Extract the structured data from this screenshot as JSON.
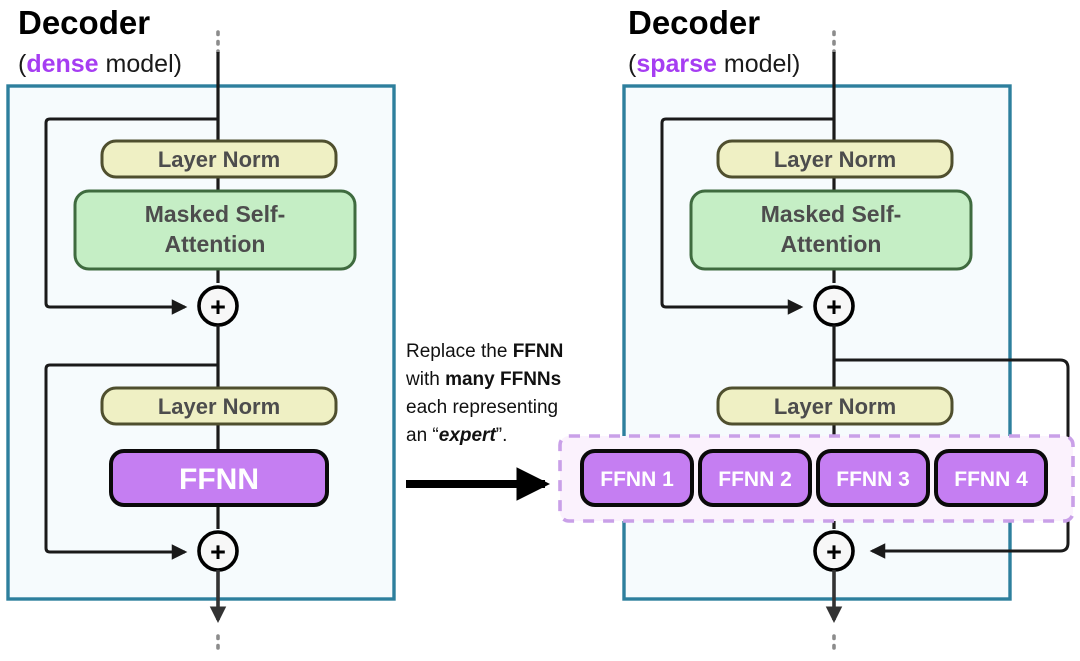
{
  "colors": {
    "background": "#ffffff",
    "decoder_border": "#2d7f9d",
    "decoder_fill": "#f6fbfd",
    "layernorm_fill": "#eff0c4",
    "layernorm_border": "#4f4f2e",
    "attention_fill": "#c5eec5",
    "attention_border": "#3f6b3f",
    "ffnn_fill": "#c57ef2",
    "ffnn_border": "#0a0a0a",
    "expert_group_fill": "#fbf2fd",
    "expert_group_border": "#c9a0e8",
    "accent_purple": "#a63df2",
    "line": "#1a1a1a",
    "dotted_line": "#8c8c8c",
    "label_text": "#4d4d4d",
    "title_text": "#000000"
  },
  "panels": [
    {
      "id": "dense",
      "title": "Decoder",
      "subtitle_open": "(",
      "subtitle_accent": "dense",
      "subtitle_rest": " model)",
      "blocks": [
        {
          "name": "layer-norm-1",
          "label": "Layer Norm",
          "kind": "layernorm"
        },
        {
          "name": "masked-self-attention",
          "label": "Masked Self-\nAttention",
          "kind": "attention",
          "line1": "Masked Self-",
          "line2": "Attention"
        },
        {
          "name": "residual-add-1",
          "label": "+",
          "kind": "add"
        },
        {
          "name": "layer-norm-2",
          "label": "Layer Norm",
          "kind": "layernorm"
        },
        {
          "name": "ffnn",
          "label": "FFNN",
          "kind": "ffnn"
        },
        {
          "name": "residual-add-2",
          "label": "+",
          "kind": "add"
        }
      ]
    },
    {
      "id": "sparse",
      "title": "Decoder",
      "subtitle_open": "(",
      "subtitle_accent": "sparse",
      "subtitle_rest": " model)",
      "blocks": [
        {
          "name": "layer-norm-1",
          "label": "Layer Norm",
          "kind": "layernorm"
        },
        {
          "name": "masked-self-attention",
          "label": "Masked Self-\nAttention",
          "kind": "attention",
          "line1": "Masked Self-",
          "line2": "Attention"
        },
        {
          "name": "residual-add-1",
          "label": "+",
          "kind": "add"
        },
        {
          "name": "layer-norm-2",
          "label": "Layer Norm",
          "kind": "layernorm"
        },
        {
          "name": "residual-add-2",
          "label": "+",
          "kind": "add"
        }
      ],
      "experts": [
        {
          "label": "FFNN 1"
        },
        {
          "label": "FFNN 2"
        },
        {
          "label": "FFNN 3"
        },
        {
          "label": "FFNN 4"
        }
      ]
    }
  ],
  "annotation": {
    "lines": [
      [
        {
          "t": "Replace the ",
          "style": "normal"
        },
        {
          "t": "FFNN",
          "style": "bold"
        }
      ],
      [
        {
          "t": "with ",
          "style": "normal"
        },
        {
          "t": "many FFNNs",
          "style": "bold"
        }
      ],
      [
        {
          "t": "each representing",
          "style": "normal"
        }
      ],
      [
        {
          "t": "an “",
          "style": "normal"
        },
        {
          "t": "expert",
          "style": "bolditalic"
        },
        {
          "t": "”.",
          "style": "normal"
        }
      ]
    ],
    "arrow_label": "transform-arrow"
  },
  "plus_symbol": "+"
}
